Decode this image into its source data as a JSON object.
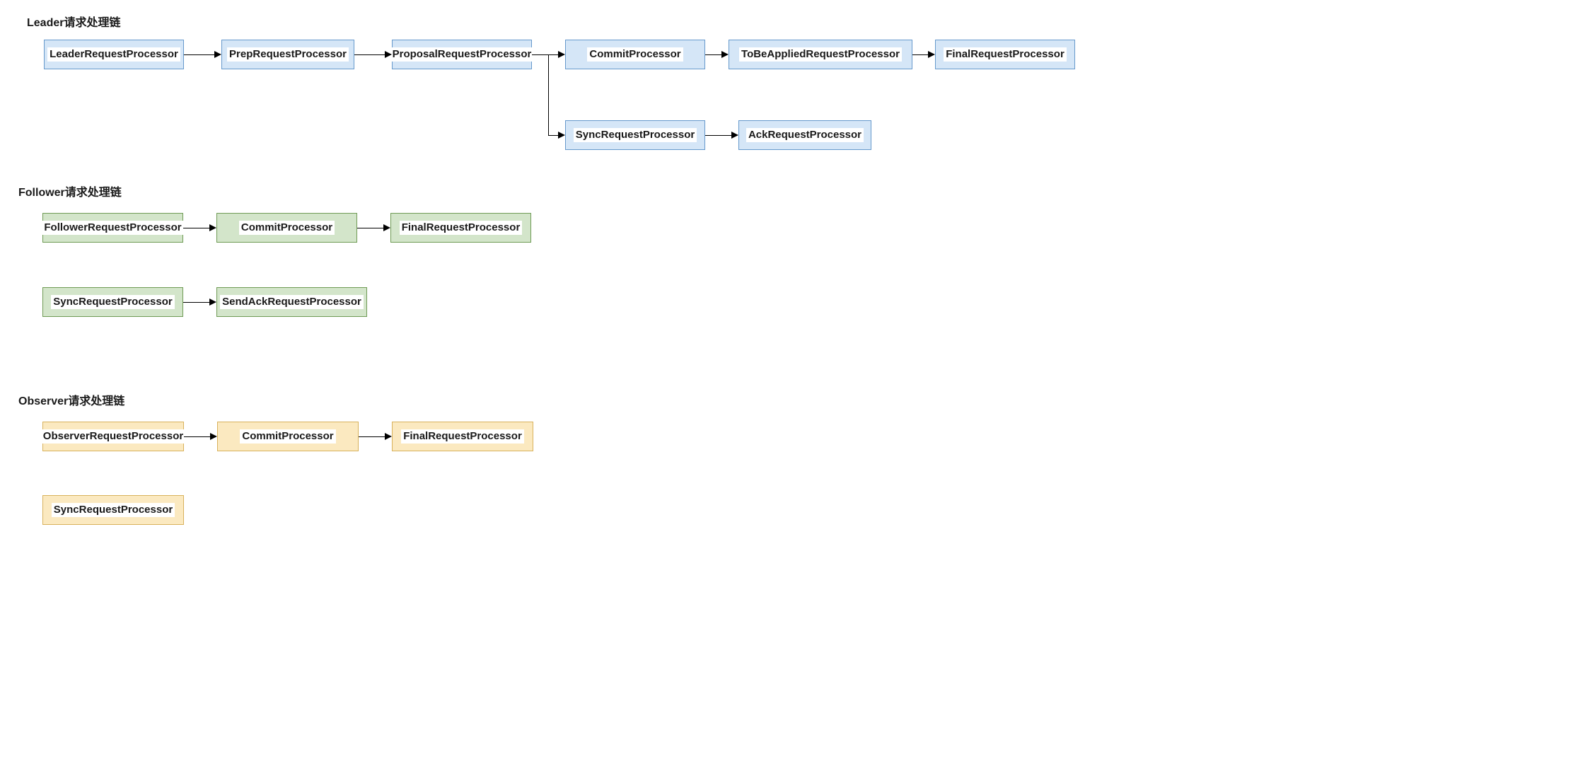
{
  "chart_data": {
    "type": "diagram",
    "sections": [
      {
        "title": "Leader请求处理链",
        "color": "blue",
        "chains": [
          [
            "LeaderRequestProcessor",
            "PrepRequestProcessor",
            "ProposalRequestProcessor",
            "CommitProcessor",
            "ToBeAppliedRequestProcessor",
            "FinalRequestProcessor"
          ],
          [
            "ProposalRequestProcessor",
            "SyncRequestProcessor",
            "AckRequestProcessor"
          ]
        ]
      },
      {
        "title": "Follower请求处理链",
        "color": "green",
        "chains": [
          [
            "FollowerRequestProcessor",
            "CommitProcessor",
            "FinalRequestProcessor"
          ],
          [
            "SyncRequestProcessor",
            "SendAckRequestProcessor"
          ]
        ]
      },
      {
        "title": "Observer请求处理链",
        "color": "yellow",
        "chains": [
          [
            "ObserverRequestProcessor",
            "CommitProcessor",
            "FinalRequestProcessor"
          ],
          [
            "SyncRequestProcessor"
          ]
        ]
      }
    ]
  },
  "titles": {
    "leader": "Leader请求处理链",
    "follower": "Follower请求处理链",
    "observer": "Observer请求处理链"
  },
  "nodes": {
    "leader1": "LeaderRequestProcessor",
    "leader2": "PrepRequestProcessor",
    "leader3": "ProposalRequestProcessor",
    "leader4": "CommitProcessor",
    "leader5": "ToBeAppliedRequestProcessor",
    "leader6": "FinalRequestProcessor",
    "leader7": "SyncRequestProcessor",
    "leader8": "AckRequestProcessor",
    "follower1": "FollowerRequestProcessor",
    "follower2": "CommitProcessor",
    "follower3": "FinalRequestProcessor",
    "follower4": "SyncRequestProcessor",
    "follower5": "SendAckRequestProcessor",
    "observer1": "ObserverRequestProcessor",
    "observer2": "CommitProcessor",
    "observer3": "FinalRequestProcessor",
    "observer4": "SyncRequestProcessor"
  }
}
